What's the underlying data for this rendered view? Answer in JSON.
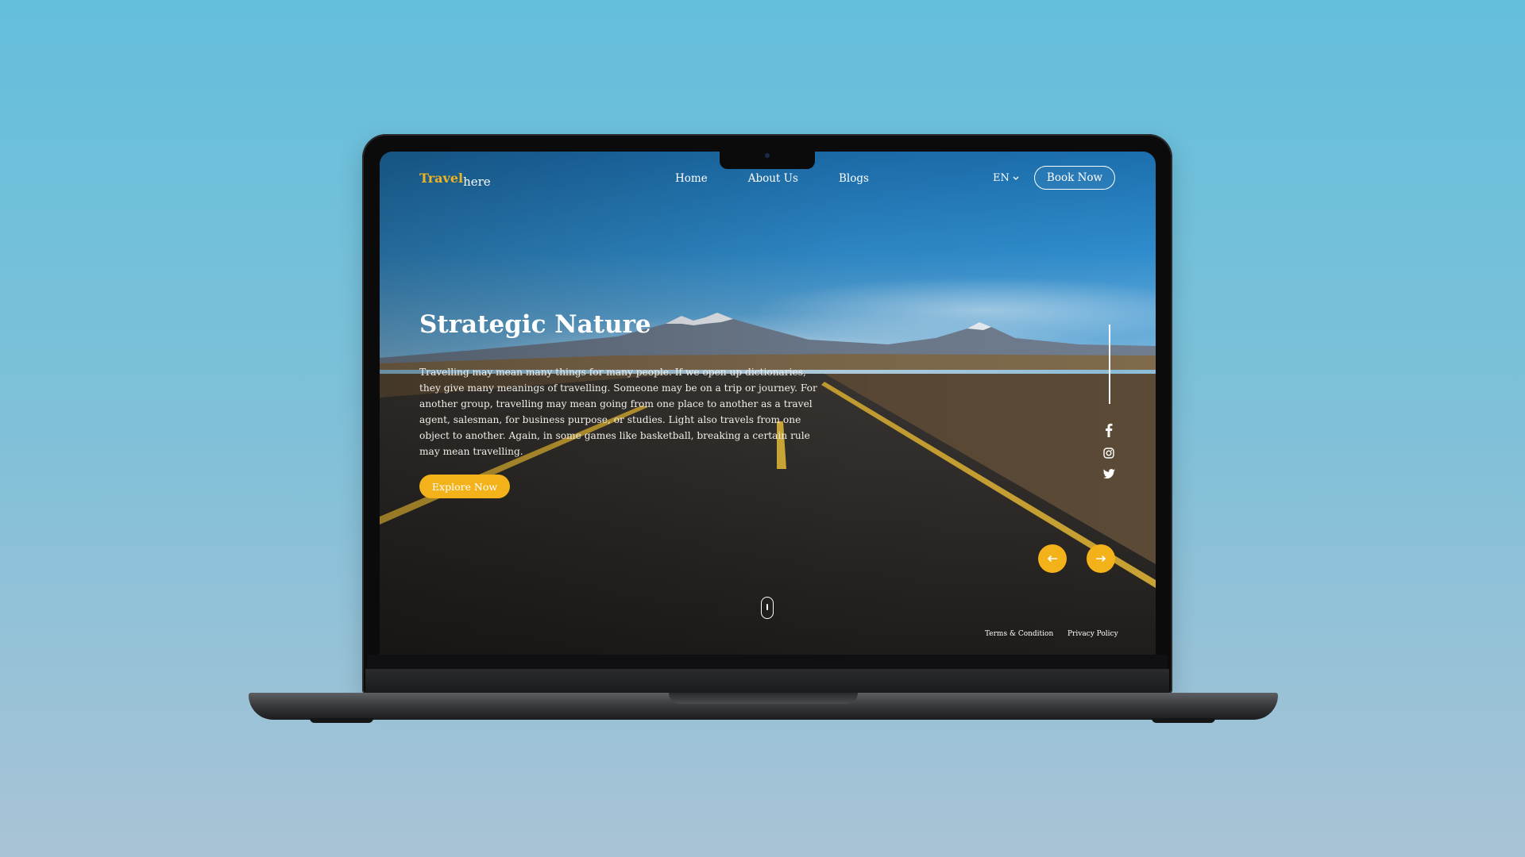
{
  "brand": {
    "part1": "Travel",
    "part2": "here",
    "accent": "#f2b320"
  },
  "nav": {
    "items": [
      "Home",
      "About Us",
      "Blogs"
    ]
  },
  "language": {
    "label": "EN"
  },
  "header": {
    "cta": "Book Now"
  },
  "hero": {
    "title": "Strategic Nature",
    "description": "Travelling may mean many things for many people. If we open up dictionaries, they give many meanings of travelling. Someone may be on a trip or journey. For another group, travelling may mean going from one place to another as a travel agent, salesman, for business purpose, or studies. Light also travels from one object to another. Again, in some games like basketball, breaking a certain rule may mean travelling.",
    "cta": "Explore Now"
  },
  "social": [
    "facebook-icon",
    "instagram-icon",
    "twitter-icon"
  ],
  "footer": {
    "terms": "Terms & Condition",
    "privacy": "Privacy Policy"
  }
}
